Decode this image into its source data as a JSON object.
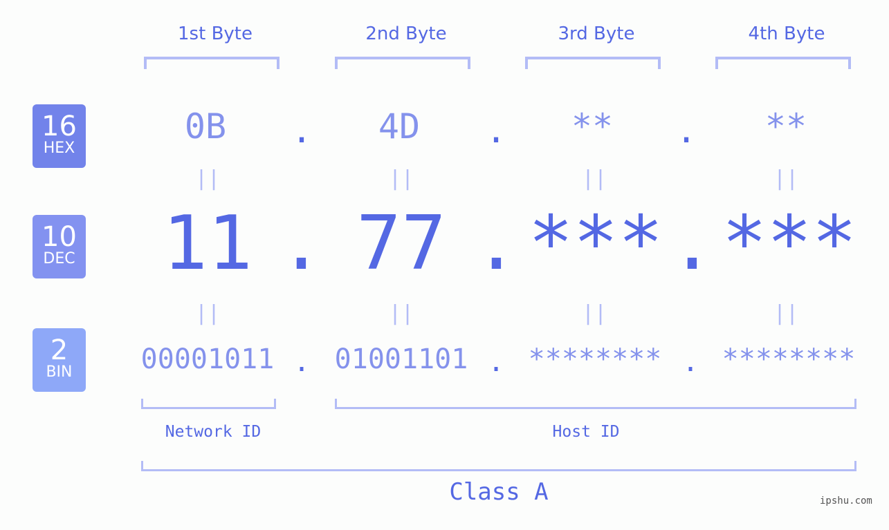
{
  "bytes": [
    {
      "label": "1st Byte",
      "hex": "0B",
      "dec": "11",
      "bin": "00001011"
    },
    {
      "label": "2nd Byte",
      "hex": "4D",
      "dec": "77",
      "bin": "01001101"
    },
    {
      "label": "3rd Byte",
      "hex": "**",
      "dec": "***",
      "bin": "********"
    },
    {
      "label": "4th Byte",
      "hex": "**",
      "dec": "***",
      "bin": "********"
    }
  ],
  "separator": ".",
  "equals": "||",
  "badges": {
    "hex": {
      "num": "16",
      "unit": "HEX",
      "color": "#7283ea"
    },
    "dec": {
      "num": "10",
      "unit": "DEC",
      "color": "#8392f0"
    },
    "bin": {
      "num": "2",
      "unit": "BIN",
      "color": "#8ea8f8"
    }
  },
  "labels": {
    "network_id": "Network ID",
    "host_id": "Host ID",
    "class": "Class A"
  },
  "watermark": "ipshu.com",
  "colors": {
    "accent": "#5468e3",
    "light": "#8492ec",
    "bracket": "#b3bcf6"
  }
}
